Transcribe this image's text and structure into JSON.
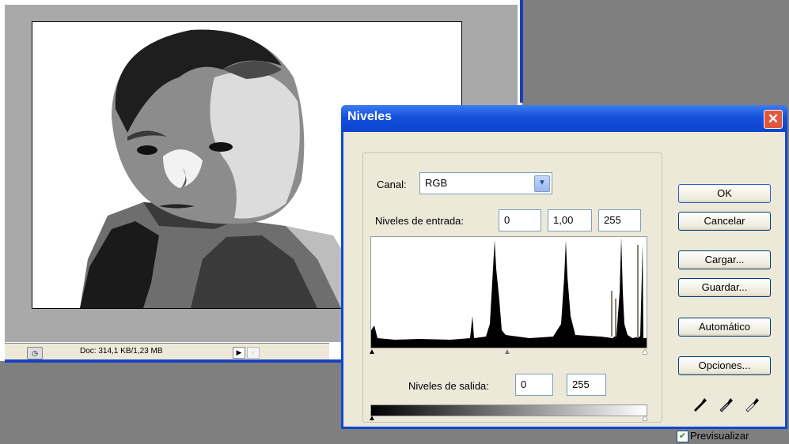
{
  "document": {
    "status_text": "Doc: 314,1 KB/1,23 MB"
  },
  "dialog": {
    "title": "Niveles",
    "channel_label": "Canal:",
    "channel_value": "RGB",
    "input_levels_label": "Niveles de entrada:",
    "input_levels": [
      "0",
      "1,00",
      "255"
    ],
    "output_levels_label": "Niveles de salida:",
    "output_levels": [
      "0",
      "255"
    ],
    "buttons": {
      "ok": "OK",
      "cancel": "Cancelar",
      "load": "Cargar...",
      "save": "Guardar...",
      "auto": "Automático",
      "options": "Opciones..."
    },
    "preview_label": "Previsualizar",
    "preview_checked": true
  },
  "colors": {
    "dialog_border": "#0b49d6",
    "dialog_face": "#ece9d8",
    "close_button": "#e2573a",
    "workspace": "#7f7f7f"
  },
  "icons": [
    "close-icon",
    "dropdown-arrow-icon",
    "eyedropper-black-icon",
    "eyedropper-gray-icon",
    "eyedropper-white-icon",
    "checkbox-check-icon",
    "status-menu-arrow-icon"
  ]
}
